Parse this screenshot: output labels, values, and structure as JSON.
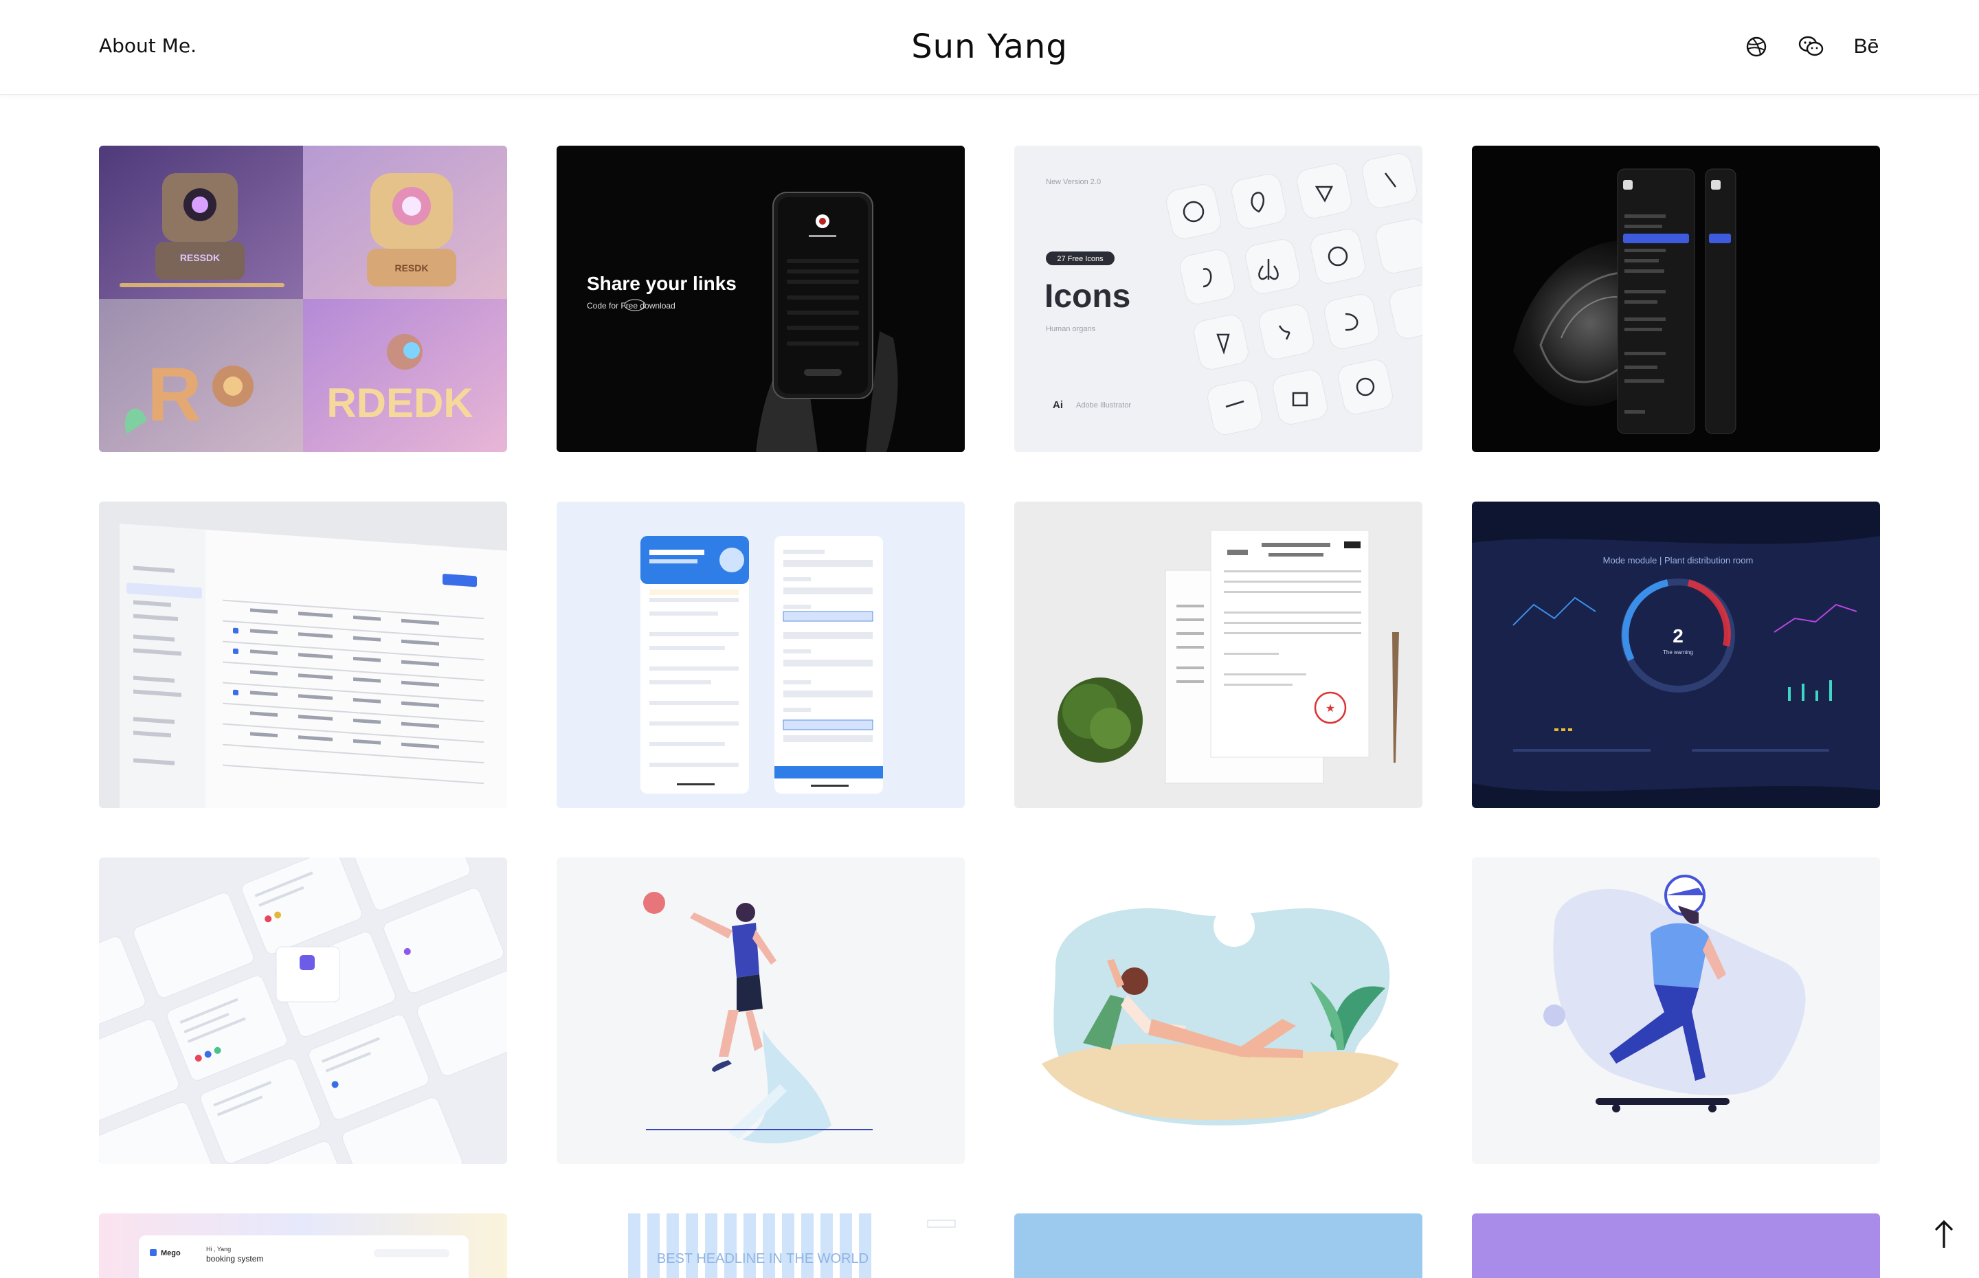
{
  "header": {
    "about_label": "About Me.",
    "brand": "Sun Yang",
    "social": [
      {
        "icon": "dribbble-icon"
      },
      {
        "icon": "wechat-icon"
      },
      {
        "label": "Bē",
        "icon": "behance-icon"
      }
    ]
  },
  "projects": {
    "robots": {
      "labels": [
        "RESSDK",
        "RESDK",
        "R",
        "RDEDK"
      ]
    },
    "share_links": {
      "title": "Share your links",
      "subtitle_prefix": "Code for ",
      "subtitle_free": "Free",
      "subtitle_suffix": " download"
    },
    "icons": {
      "version": "New Version 2.0",
      "badge": "27 Free Icons",
      "title": "Icons",
      "subtitle": "Human organs",
      "tool_badge": "Ai",
      "tool": "Adobe Illustrator"
    },
    "dashboard": {
      "title": "Mode module | Plant distribution room",
      "value": "2",
      "label": "The warning"
    },
    "bottom_headline": "BEST HEADLINE IN THE WORLD",
    "booking": {
      "logo": "Mego",
      "line1": "Hi , Yang",
      "line2": "booking system"
    }
  },
  "colors": {
    "card_blue": "#9ccaee",
    "card_purple": "#a98cea",
    "dark_bg": "#0a0a0a",
    "navy_bg": "#101736"
  }
}
